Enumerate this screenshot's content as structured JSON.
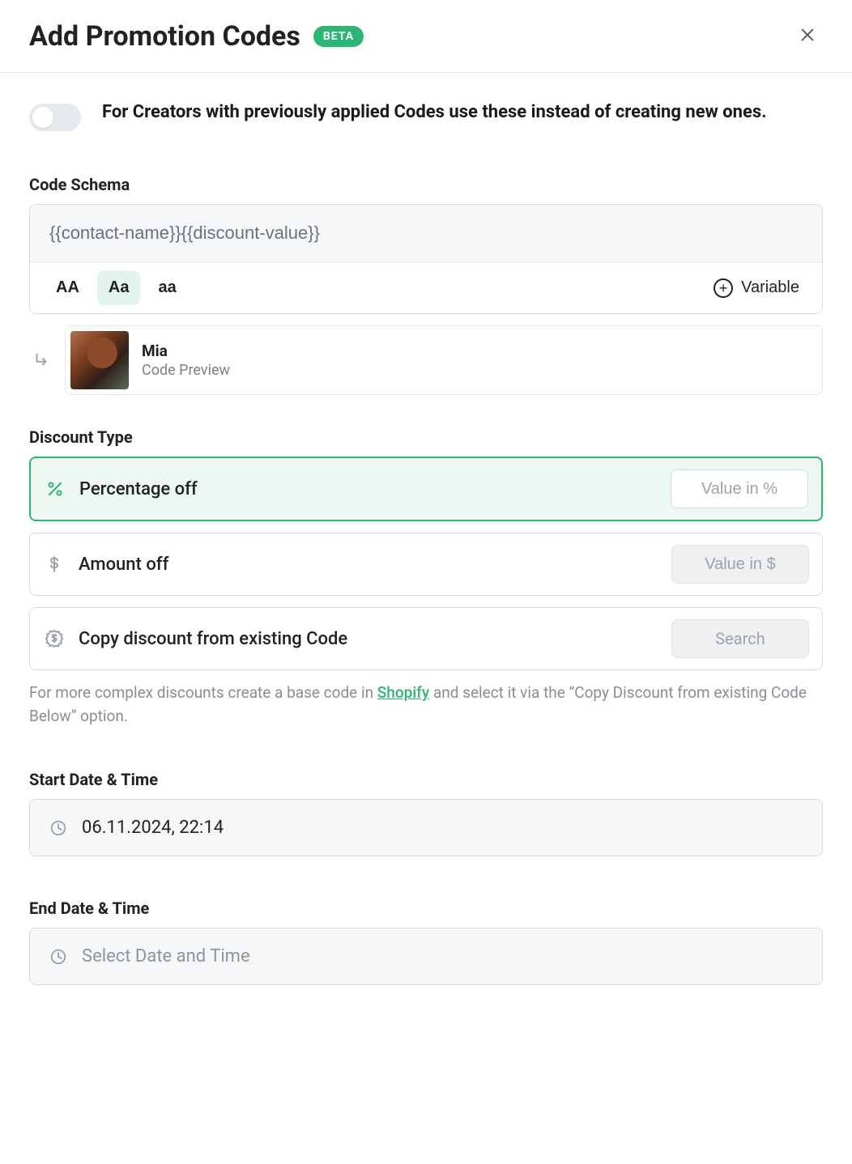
{
  "header": {
    "title": "Add Promotion Codes",
    "badge": "BETA"
  },
  "toggle": {
    "description": "For Creators with previously applied Codes use these instead of creating new ones."
  },
  "schema": {
    "label": "Code Schema",
    "value": "{{contact-name}}{{discount-value}}",
    "case_options": {
      "upper": "AA",
      "title": "Aa",
      "lower": "aa"
    },
    "variable_button": "Variable"
  },
  "preview": {
    "name": "Mia",
    "subtitle": "Code Preview"
  },
  "discount": {
    "label": "Discount Type",
    "options": {
      "percentage": {
        "label": "Percentage off",
        "placeholder": "Value in %"
      },
      "amount": {
        "label": "Amount off",
        "placeholder": "Value in $"
      },
      "copy": {
        "label": "Copy discount from existing Code",
        "action": "Search"
      }
    },
    "helper_pre": "For more complex discounts create a base code in ",
    "helper_link": "Shopify",
    "helper_post": " and select it via the “Copy Discount from existing Code Below” option."
  },
  "start": {
    "label": "Start Date & Time",
    "value": "06.11.2024, 22:14"
  },
  "end": {
    "label": "End Date & Time",
    "placeholder": "Select Date and Time"
  }
}
